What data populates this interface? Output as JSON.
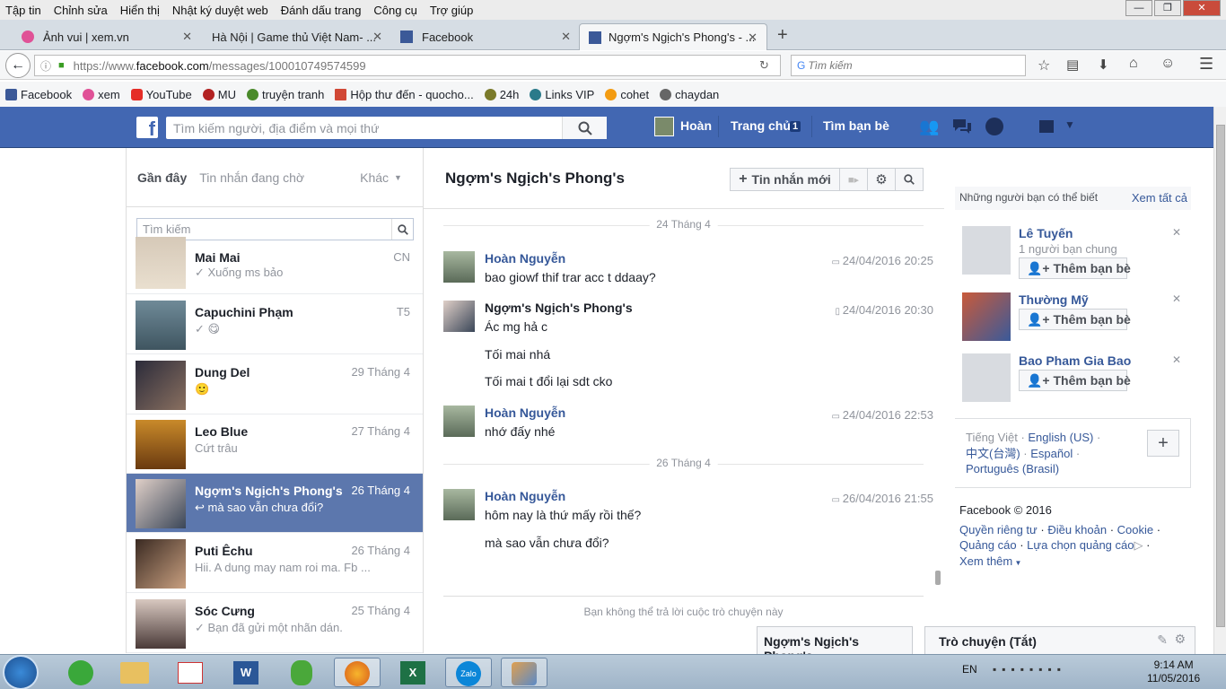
{
  "menubar": {
    "items": [
      "Tập tin",
      "Chỉnh sửa",
      "Hiển thị",
      "Nhật ký duyệt web",
      "Đánh dấu trang",
      "Công cụ",
      "Trợ giúp"
    ]
  },
  "tabs": [
    {
      "label": "Ảnh vui | xem.vn"
    },
    {
      "label": "Hà Nội | Game thủ Việt Nam- ..."
    },
    {
      "label": "Facebook"
    },
    {
      "label": "Ngợm's Ngịch's Phong's - ..."
    }
  ],
  "navbar": {
    "url_prefix": "https://www.",
    "url_domain": "facebook.com",
    "url_path": "/messages/100010749574599",
    "search_placeholder": "Tìm kiếm"
  },
  "bookmarks": [
    {
      "label": "Facebook",
      "color": "#3b5998"
    },
    {
      "label": "xem",
      "color": "#e05297"
    },
    {
      "label": "YouTube",
      "color": "#e52d27"
    },
    {
      "label": "MU",
      "color": "#b22222"
    },
    {
      "label": "truyện tranh",
      "color": "#4a8a2a"
    },
    {
      "label": "Hộp thư đến - quocho...",
      "color": "#d14836"
    },
    {
      "label": "24h",
      "color": "#7a7a2a"
    },
    {
      "label": "Links VIP",
      "color": "#2a7a8a"
    },
    {
      "label": "cohet",
      "color": "#f39c12"
    },
    {
      "label": "chaydan",
      "color": "#666666"
    }
  ],
  "fbbar": {
    "search_placeholder": "Tìm kiếm người, địa điểm và mọi thứ",
    "user_name": "Hoàn",
    "home_label": "Trang chủ",
    "home_count": "1",
    "find_friends": "Tìm bạn bè"
  },
  "left": {
    "tab_recent": "Gần đây",
    "tab_pending": "Tin nhắn đang chờ",
    "tab_other": "Khác",
    "search_placeholder": "Tìm kiếm",
    "conversations": [
      {
        "name": "Mai Mai",
        "date": "CN",
        "snippet": "Xuống ms bảo"
      },
      {
        "name": "Capuchini Phạm",
        "date": "T5",
        "snippet": "😋"
      },
      {
        "name": "Dung Del",
        "date": "29 Tháng 4",
        "snippet": "🙂"
      },
      {
        "name": "Leo Blue",
        "date": "27 Tháng 4",
        "snippet": "Cứt trâu"
      },
      {
        "name": "Ngợm's Ngịch's Phong's",
        "date": "26 Tháng 4",
        "snippet": "mà sao vẫn chưa đổi?"
      },
      {
        "name": "Puti Êchu",
        "date": "26 Tháng 4",
        "snippet": "Hii. A dung may nam roi ma. Fb ..."
      },
      {
        "name": "Sóc Cưng",
        "date": "25 Tháng 4",
        "snippet": "Bạn đã gửi một nhãn dán."
      }
    ]
  },
  "thread": {
    "title": "Ngợm's Ngịch's Phong's",
    "new_message_label": "Tin nhắn mới",
    "date_sep_1": "24 Tháng 4",
    "date_sep_2": "26 Tháng 4",
    "messages": [
      {
        "sender": "Hoàn Nguyễn",
        "time": "24/04/2016 20:25",
        "lines": [
          "bao giowf thif trar acc t ddaay?"
        ]
      },
      {
        "sender": "Ngợm's Ngịch's Phong's",
        "time": "24/04/2016 20:30",
        "lines": [
          "Ác mg hả c",
          "Tối mai nhá",
          "Tối mai t đổi lại sdt cko"
        ]
      },
      {
        "sender": "Hoàn Nguyễn",
        "time": "24/04/2016 22:53",
        "lines": [
          "nhớ đấy nhé"
        ]
      },
      {
        "sender": "Hoàn Nguyễn",
        "time": "26/04/2016 21:55",
        "lines": [
          "hôm nay là thứ mấy rồi thế?",
          "mà sao vẫn chưa đổi?"
        ]
      }
    ],
    "cant_reply": "Bạn không thể trả lời cuộc trò chuyện này"
  },
  "right": {
    "pymk_title": "Những người bạn có thể biết",
    "see_all": "Xem tất cả",
    "people": [
      {
        "name": "Lê Tuyến",
        "mutual": "1 người bạn chung",
        "button": "Thêm bạn bè"
      },
      {
        "name": "Thường Mỹ",
        "mutual": "",
        "button": "Thêm bạn bè"
      },
      {
        "name": "Bao Pham Gia Bao",
        "mutual": "",
        "button": "Thêm bạn bè"
      }
    ],
    "languages": {
      "current": "Tiếng Việt",
      "l1": "English (US)",
      "l2": "中文(台灣)",
      "l3": "Español",
      "l4": "Português (Brasil)"
    },
    "footer": {
      "copyright": "Facebook © 2016",
      "privacy": "Quyền riêng tư",
      "terms": "Điều khoản",
      "cookie": "Cookie",
      "ads": "Quảng cáo",
      "ad_choices": "Lựa chọn quảng cáo",
      "more": "Xem thêm"
    }
  },
  "chat": {
    "tab1": "Ngợm's Ngịch's Phong's",
    "tab2": "Trò chuyện (Tắt)"
  },
  "taskbar": {
    "lang": "EN",
    "time": "9:14 AM",
    "date": "11/05/2016"
  }
}
